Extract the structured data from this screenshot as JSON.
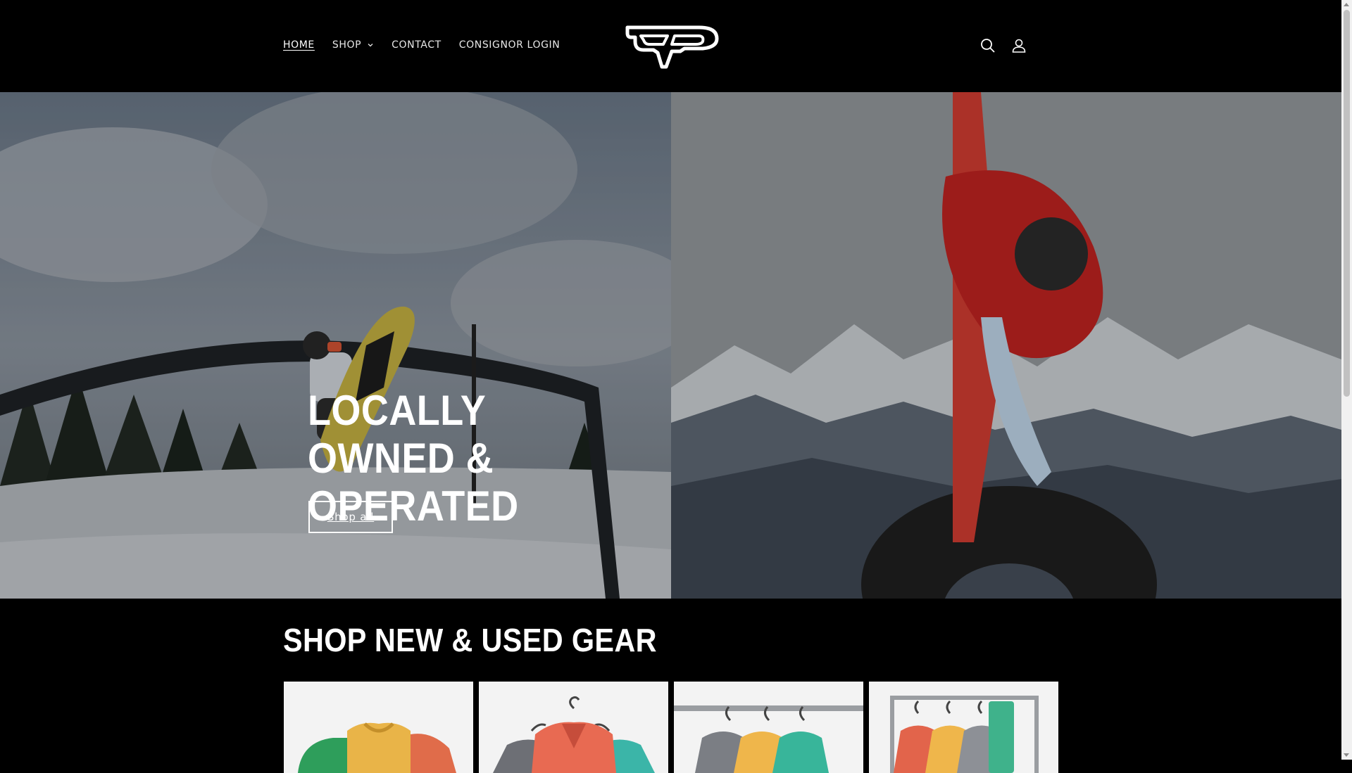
{
  "header": {
    "nav": [
      {
        "label": "HOME",
        "active": true
      },
      {
        "label": "SHOP",
        "has_dropdown": true
      },
      {
        "label": "CONTACT"
      },
      {
        "label": "CONSIGNOR LOGIN"
      }
    ],
    "logo_icon": "tp-logo-icon",
    "icons": [
      "search-icon",
      "account-icon"
    ]
  },
  "hero": {
    "title": "LOCALLY OWNED & OPERATED",
    "button_label": "Shop all",
    "left_image": "snowboarder-on-rail-photo",
    "right_image": "snowboarder-on-tire-photo"
  },
  "section": {
    "title": "SHOP NEW & USED GEAR",
    "cards": [
      "folded-shirts-illustration",
      "hanging-shirts-illustration",
      "clothes-rail-illustration",
      "clothing-rack-illustration"
    ]
  },
  "colors": {
    "background": "#000000",
    "text": "#ffffff",
    "card_background": "#f3f3f3"
  }
}
